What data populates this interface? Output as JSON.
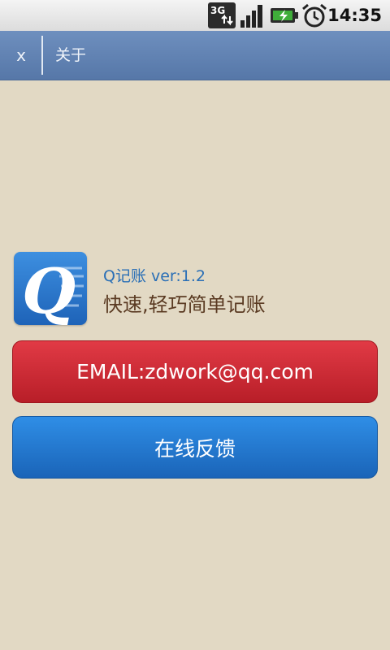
{
  "status_bar": {
    "network_type": "3G",
    "time": "14:35",
    "icons": [
      "network-3g-icon",
      "signal-strength-icon",
      "battery-charging-icon",
      "alarm-clock-icon"
    ]
  },
  "title_bar": {
    "close_label": "x",
    "title": "关于"
  },
  "app_info": {
    "version": "Q记账 ver:1.2",
    "slogan": "快速,轻巧简单记账",
    "logo_letter": "Q"
  },
  "buttons": {
    "email_label": "EMAIL:zdwork@qq.com",
    "feedback_label": "在线反馈"
  },
  "colors": {
    "background": "#e2d9c4",
    "title_bar": "#5f80b1",
    "email_button": "#c8252f",
    "feedback_button": "#2479cf",
    "version_text": "#2a6fb6",
    "slogan_text": "#5a3a22"
  }
}
